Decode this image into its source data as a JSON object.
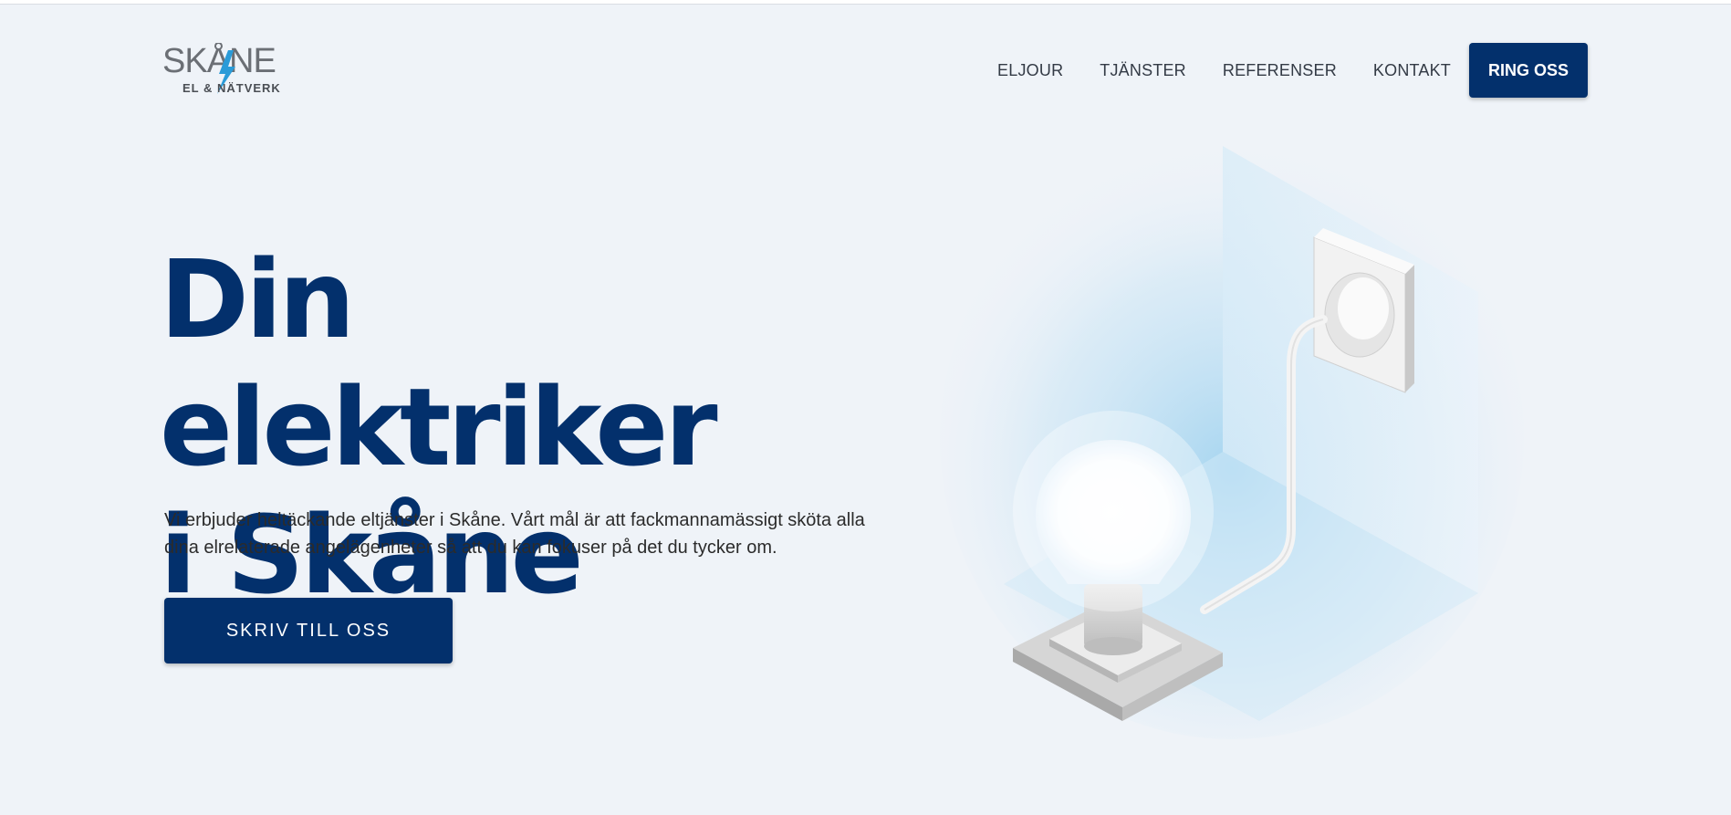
{
  "logo": {
    "word": "SKÅNE",
    "sub": "EL & NÄTVERK"
  },
  "nav": {
    "items": [
      {
        "label": "ELJOUR"
      },
      {
        "label": "TJÄNSTER"
      },
      {
        "label": "REFERENSER"
      },
      {
        "label": "KONTAKT"
      }
    ],
    "cta_label": "RING OSS"
  },
  "hero": {
    "title_line1": "Din elektriker",
    "title_line2": "i Skåne",
    "text": "Vi erbjuder heltäckande eltjänster i Skåne. Vårt mål är att fackmannamässigt sköta alla dina elrelaterade angelägenheter så att du kan fokuser på det du tycker om.",
    "button_label": "SKRIV TILL OSS"
  },
  "colors": {
    "brand": "#03306c",
    "background": "#eff3f8",
    "accent": "#2a9bd8"
  },
  "icons": [
    "bolt-logo-icon",
    "lightbulb-illustration",
    "wall-socket-illustration"
  ]
}
